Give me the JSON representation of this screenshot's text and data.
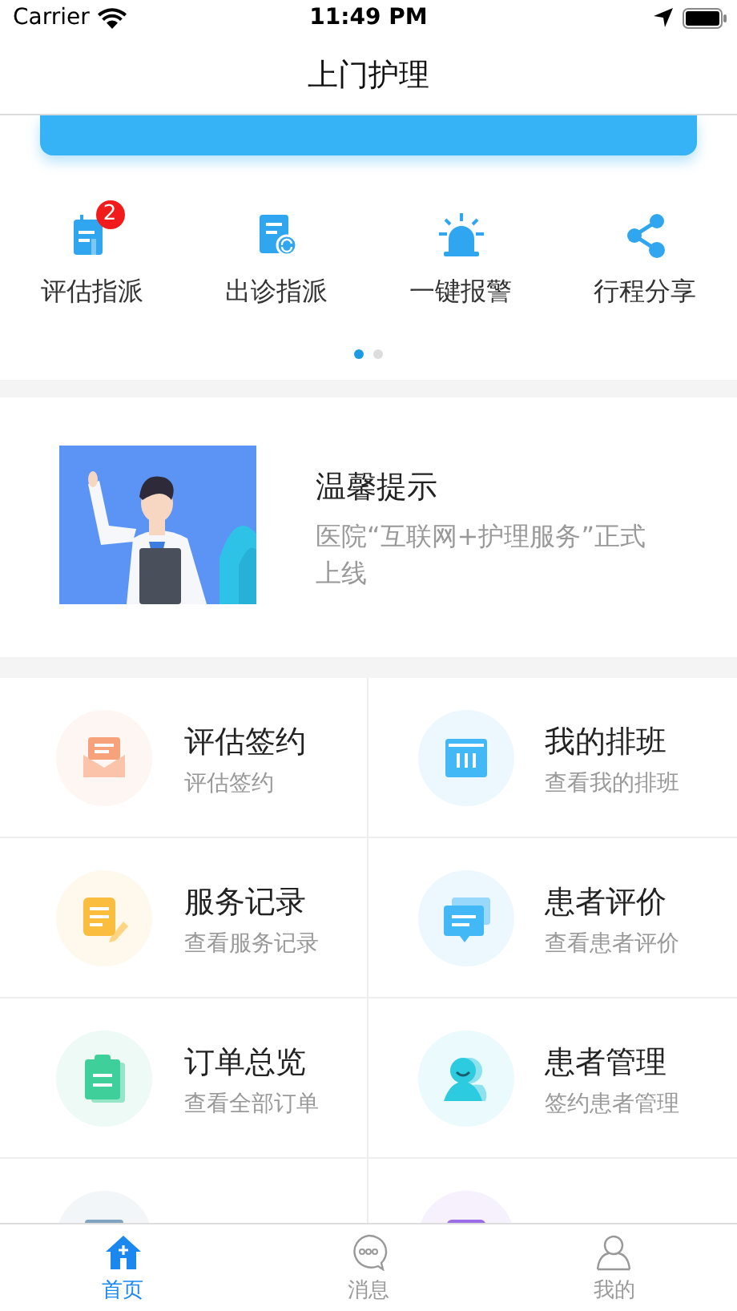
{
  "status_bar": {
    "carrier": "Carrier",
    "time": "11:49 PM"
  },
  "nav": {
    "title": "上门护理"
  },
  "quick_actions": [
    {
      "label": "评估指派",
      "badge": "2"
    },
    {
      "label": "出诊指派"
    },
    {
      "label": "一键报警"
    },
    {
      "label": "行程分享"
    }
  ],
  "page_dots": [
    {
      "selected": true
    },
    {
      "selected": false
    }
  ],
  "notice": {
    "title": "温馨提示",
    "text": "医院“互联网+护理服务”正式上线"
  },
  "menu": [
    {
      "title": "评估签约",
      "subtitle": "评估签约",
      "color": "#f7a27a"
    },
    {
      "title": "我的排班",
      "subtitle": "查看我的排班",
      "color": "#42b8f7"
    },
    {
      "title": "服务记录",
      "subtitle": "查看服务记录",
      "color": "#fbbd3e"
    },
    {
      "title": "患者评价",
      "subtitle": "查看患者评价",
      "color": "#42b8f7"
    },
    {
      "title": "订单总览",
      "subtitle": "查看全部订单",
      "color": "#3ecf9a"
    },
    {
      "title": "患者管理",
      "subtitle": "签约患者管理",
      "color": "#2dcbe0"
    },
    {
      "color": "#7fa3c0"
    },
    {
      "color": "#9b6de8"
    }
  ],
  "tabs": [
    {
      "label": "首页",
      "selected": true
    },
    {
      "label": "消息",
      "selected": false
    },
    {
      "label": "我的",
      "selected": false
    }
  ]
}
